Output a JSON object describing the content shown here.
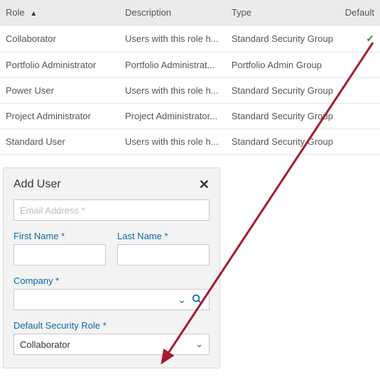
{
  "table": {
    "headers": {
      "role": "Role",
      "description": "Description",
      "type": "Type",
      "default": "Default"
    },
    "rows": [
      {
        "role": "Collaborator",
        "description": "Users with this role h...",
        "type": "Standard Security Group",
        "default": true
      },
      {
        "role": "Portfolio Administrator",
        "description": "Portfolio Administrat...",
        "type": "Portfolio Admin Group",
        "default": false
      },
      {
        "role": "Power User",
        "description": "Users with this role h...",
        "type": "Standard Security Group",
        "default": false
      },
      {
        "role": "Project Administrator",
        "description": "Project Administrator...",
        "type": "Standard Security Group",
        "default": false
      },
      {
        "role": "Standard User",
        "description": "Users with this role h...",
        "type": "Standard Security Group",
        "default": false
      }
    ]
  },
  "panel": {
    "title": "Add User",
    "email_placeholder": "Email Address *",
    "first_name_label": "First Name *",
    "last_name_label": "Last Name *",
    "company_label": "Company *",
    "default_role_label": "Default Security Role *",
    "default_role_value": "Collaborator"
  },
  "annotation": {
    "arrow_color": "#a51c30"
  }
}
